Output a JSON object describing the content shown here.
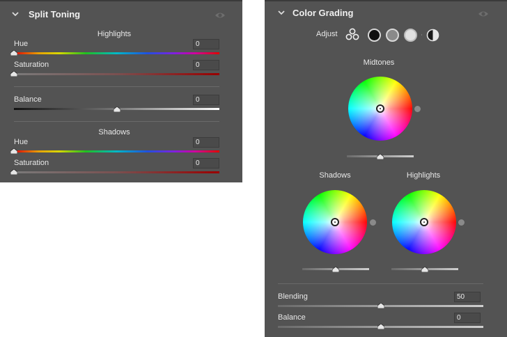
{
  "split_toning": {
    "title": "Split Toning",
    "highlights": {
      "heading": "Highlights",
      "hue_label": "Hue",
      "hue_value": "0",
      "saturation_label": "Saturation",
      "saturation_value": "0"
    },
    "balance": {
      "label": "Balance",
      "value": "0"
    },
    "shadows": {
      "heading": "Shadows",
      "hue_label": "Hue",
      "hue_value": "0",
      "saturation_label": "Saturation",
      "saturation_value": "0"
    }
  },
  "color_grading": {
    "title": "Color Grading",
    "adjust_label": "Adjust",
    "midtones_label": "Midtones",
    "shadows_label": "Shadows",
    "highlights_label": "Highlights",
    "blending": {
      "label": "Blending",
      "value": "50"
    },
    "balance": {
      "label": "Balance",
      "value": "0"
    }
  }
}
